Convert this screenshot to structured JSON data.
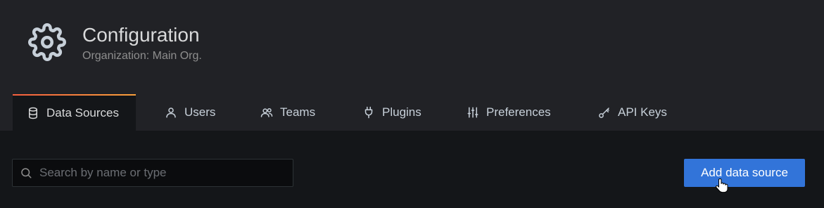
{
  "header": {
    "title": "Configuration",
    "subtitle": "Organization: Main Org.",
    "icon": "gear-icon"
  },
  "tabs": [
    {
      "label": "Data Sources",
      "icon": "database-icon",
      "active": true
    },
    {
      "label": "Users",
      "icon": "user-icon",
      "active": false
    },
    {
      "label": "Teams",
      "icon": "users-icon",
      "active": false
    },
    {
      "label": "Plugins",
      "icon": "plug-icon",
      "active": false
    },
    {
      "label": "Preferences",
      "icon": "sliders-icon",
      "active": false
    },
    {
      "label": "API Keys",
      "icon": "key-icon",
      "active": false
    }
  ],
  "search": {
    "placeholder": "Search by name or type",
    "value": ""
  },
  "actions": {
    "add_label": "Add data source"
  },
  "colors": {
    "accent": "#3274d9",
    "active_tab_border_start": "#f55f3e",
    "active_tab_border_end": "#f9a03c",
    "header_bg": "#212226",
    "page_bg": "#141619"
  }
}
